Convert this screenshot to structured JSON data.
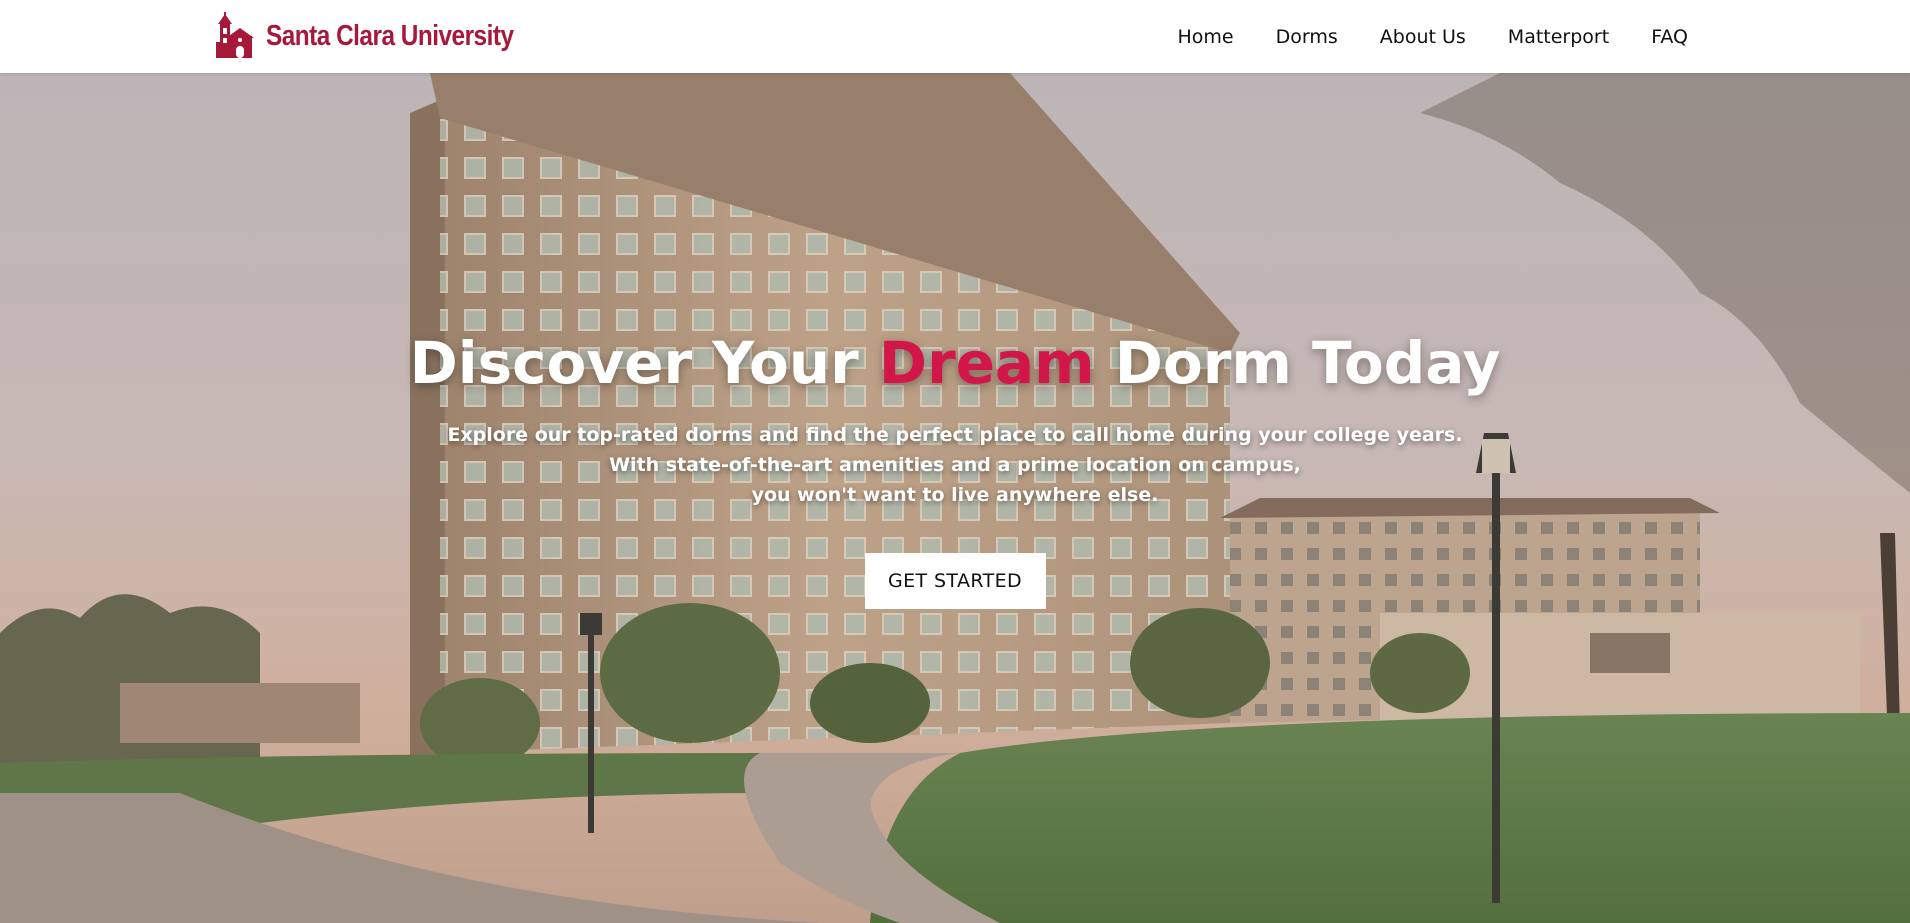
{
  "header": {
    "logo_text": "Santa Clara University",
    "logo_icon": "mission-church-icon",
    "brand_color": "#a6193a"
  },
  "nav": {
    "items": [
      {
        "label": "Home"
      },
      {
        "label": "Dorms"
      },
      {
        "label": "About Us"
      },
      {
        "label": "Matterport"
      },
      {
        "label": "FAQ"
      }
    ]
  },
  "hero": {
    "title_before": "Discover Your ",
    "title_accent": "Dream",
    "title_after": " Dorm Today",
    "accent_color": "#d3164a",
    "description_lines": [
      "Explore our top-rated dorms and find the perfect place to call home during your college years.",
      "With state-of-the-art amenities and a prime location on campus,",
      "you won't want to live anywhere else."
    ],
    "cta_label": "GET STARTED",
    "background": "campus-dorm-building-photo"
  }
}
